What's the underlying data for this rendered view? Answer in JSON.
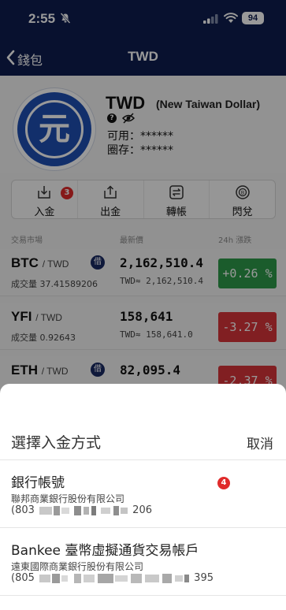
{
  "status_bar": {
    "time": "2:55",
    "battery": "94"
  },
  "nav": {
    "back_label": "錢包",
    "title": "TWD"
  },
  "coin": {
    "logo_char": "元",
    "symbol": "TWD",
    "full_name": "(New Taiwan Dollar)",
    "help": "?",
    "available_label": "可用：",
    "available_value": "******",
    "locked_label": "圈存：",
    "locked_value": "******"
  },
  "actions": [
    {
      "label": "入金",
      "icon": "deposit-icon",
      "badge": "3"
    },
    {
      "label": "出金",
      "icon": "withdraw-icon"
    },
    {
      "label": "轉帳",
      "icon": "transfer-icon"
    },
    {
      "label": "閃兌",
      "icon": "swap-icon"
    }
  ],
  "market_header": {
    "pair": "交易市場",
    "price": "最新價",
    "change": "24h 漲跌"
  },
  "markets": [
    {
      "base": "BTC",
      "quote": "/ TWD",
      "borrow": "借",
      "volume": "成交量 37.41589206",
      "price": "2,162,510.4",
      "twd_equiv": "TWD≈ 2,162,510.4",
      "change": "+0.26 %",
      "change_color": "#2e9a4a"
    },
    {
      "base": "YFI",
      "quote": "/ TWD",
      "volume": "成交量 0.92643",
      "price": "158,641",
      "twd_equiv": "TWD≈ 158,641.0",
      "change": "-3.27 %",
      "change_color": "#d8353a"
    },
    {
      "base": "ETH",
      "quote": "/ TWD",
      "borrow": "借",
      "price": "82,095.4",
      "change": "-2.37 %",
      "change_color": "#d8353a"
    }
  ],
  "sheet": {
    "title": "選擇入金方式",
    "cancel": "取消",
    "options": [
      {
        "title": "銀行帳號",
        "bank": "聯邦商業銀行股份有限公司",
        "acct_prefix": "(803",
        "acct_suffix": "206",
        "badge": "4"
      },
      {
        "title": "Bankee 臺幣虛擬通貨交易帳戶",
        "bank": "遠東國際商業銀行股份有限公司",
        "acct_prefix": "(805",
        "acct_suffix": "395"
      }
    ]
  },
  "colors": {
    "navy": "#0e1d4f",
    "up": "#2e9a4a",
    "down": "#d8353a",
    "badge": "#e02b2b"
  }
}
